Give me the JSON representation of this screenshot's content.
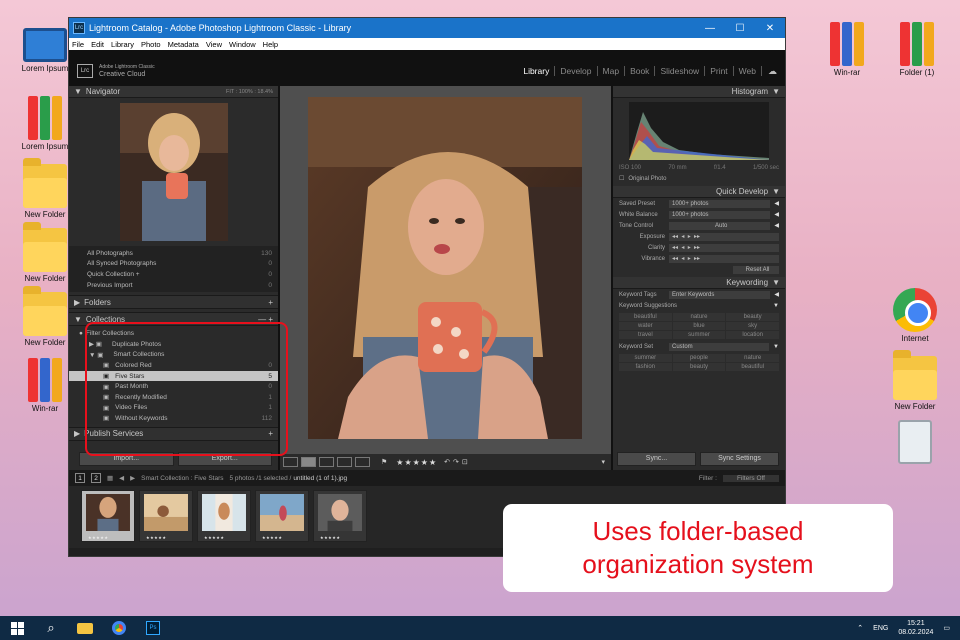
{
  "desktop": {
    "left_icons": [
      "Lorem Ipsum",
      "Lorem Ipsum",
      "New Folder",
      "New Folder",
      "New Folder",
      "Win-rar"
    ],
    "right_icons": [
      "Win-rar",
      "Folder (1)",
      "Internet",
      "New Folder"
    ]
  },
  "window": {
    "title": "Lightroom Catalog - Adobe Photoshop Lightroom Classic - Library",
    "badge": "Lrc",
    "controls": [
      "—",
      "☐",
      "✕"
    ],
    "menu": [
      "File",
      "Edit",
      "Library",
      "Photo",
      "Metadata",
      "View",
      "Window",
      "Help"
    ],
    "brand_top": "Adobe Lightroom Classic",
    "brand_bottom": "Creative Cloud",
    "modules": [
      "Library",
      "Develop",
      "Map",
      "Book",
      "Slideshow",
      "Print",
      "Web"
    ],
    "active_module": "Library"
  },
  "left_panel": {
    "navigator": {
      "title": "Navigator",
      "zoom_options": "FIT  :  100%  :  18.4%"
    },
    "catalog": [
      {
        "label": "All Photographs",
        "count": "130"
      },
      {
        "label": "All Synced Photographs",
        "count": "0"
      },
      {
        "label": "Quick Collection +",
        "count": "0"
      },
      {
        "label": "Previous Import",
        "count": "0"
      }
    ],
    "folders_title": "Folders",
    "collections_title": "Collections",
    "filter_label": "Filter Collections",
    "collections": [
      {
        "label": "Duplicate Photos",
        "count": ""
      },
      {
        "label": "Smart Collections",
        "count": ""
      },
      {
        "label": "Colored Red",
        "count": "0"
      },
      {
        "label": "Five Stars",
        "count": "5"
      },
      {
        "label": "Past Month",
        "count": "0"
      },
      {
        "label": "Recently Modified",
        "count": "1"
      },
      {
        "label": "Video Files",
        "count": "1"
      },
      {
        "label": "Without Keywords",
        "count": "112"
      }
    ],
    "publish_title": "Publish Services",
    "import_label": "Import...",
    "export_label": "Export..."
  },
  "right_panel": {
    "histogram_title": "Histogram",
    "histogram_info": [
      "ISO 100",
      "70 mm",
      "f/1.4",
      "1/500 sec"
    ],
    "original_photo": "Original Photo",
    "quick_develop_title": "Quick Develop",
    "saved_preset_label": "Saved Preset",
    "saved_preset_value": "1000+ photos",
    "white_balance_label": "White Balance",
    "white_balance_value": "1000+ photos",
    "tone_control_label": "Tone Control",
    "auto_label": "Auto",
    "exposure_label": "Exposure",
    "clarity_label": "Clarity",
    "vibrance_label": "Vibrance",
    "reset_label": "Reset All",
    "keywording_title": "Keywording",
    "keyword_tags_label": "Keyword Tags",
    "keyword_tags_value": "Enter Keywords",
    "keyword_suggestions_title": "Keyword Suggestions",
    "suggestions": [
      "beautiful",
      "nature",
      "beauty",
      "water",
      "blue",
      "sky",
      "travel",
      "summer",
      "location"
    ],
    "keyword_set_label": "Keyword Set",
    "keyword_set_value": "Custom",
    "keyword_set": [
      "summer",
      "people",
      "nature",
      "fashion",
      "beauty",
      "beautiful"
    ],
    "sync_label": "Sync...",
    "sync_settings_label": "Sync Settings"
  },
  "toolbar": {
    "stars": "★★★★★"
  },
  "filmstrip_bar": {
    "page1": "1",
    "page2": "2",
    "source": "Smart Collection : Five Stars",
    "info": "5 photos /1 selected /",
    "file": "untitled (1 of 1).jpg",
    "filter_label": "Filter :",
    "filter_value": "Filters Off"
  },
  "filmstrip": {
    "stars": "★★★★★"
  },
  "callout": {
    "line1": "Uses folder-based",
    "line2": "organization system"
  },
  "taskbar": {
    "lang": "ENG",
    "time": "15:21",
    "date": "08.02.2024"
  }
}
